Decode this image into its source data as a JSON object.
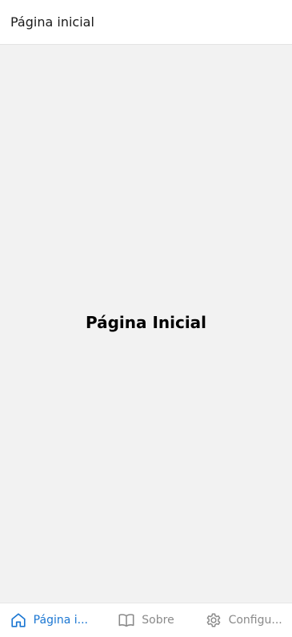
{
  "header": {
    "title": "Página inicial"
  },
  "main": {
    "heading": "Página Inicial"
  },
  "tabbar": {
    "tabs": [
      {
        "label": "Página i...",
        "icon": "home-icon",
        "active": true
      },
      {
        "label": "Sobre",
        "icon": "book-icon",
        "active": false
      },
      {
        "label": "Configu...",
        "icon": "gear-icon",
        "active": false
      }
    ]
  },
  "colors": {
    "accent": "#1a76d2",
    "inactive": "#8a8a8a",
    "content_background": "#f2f2f2"
  }
}
